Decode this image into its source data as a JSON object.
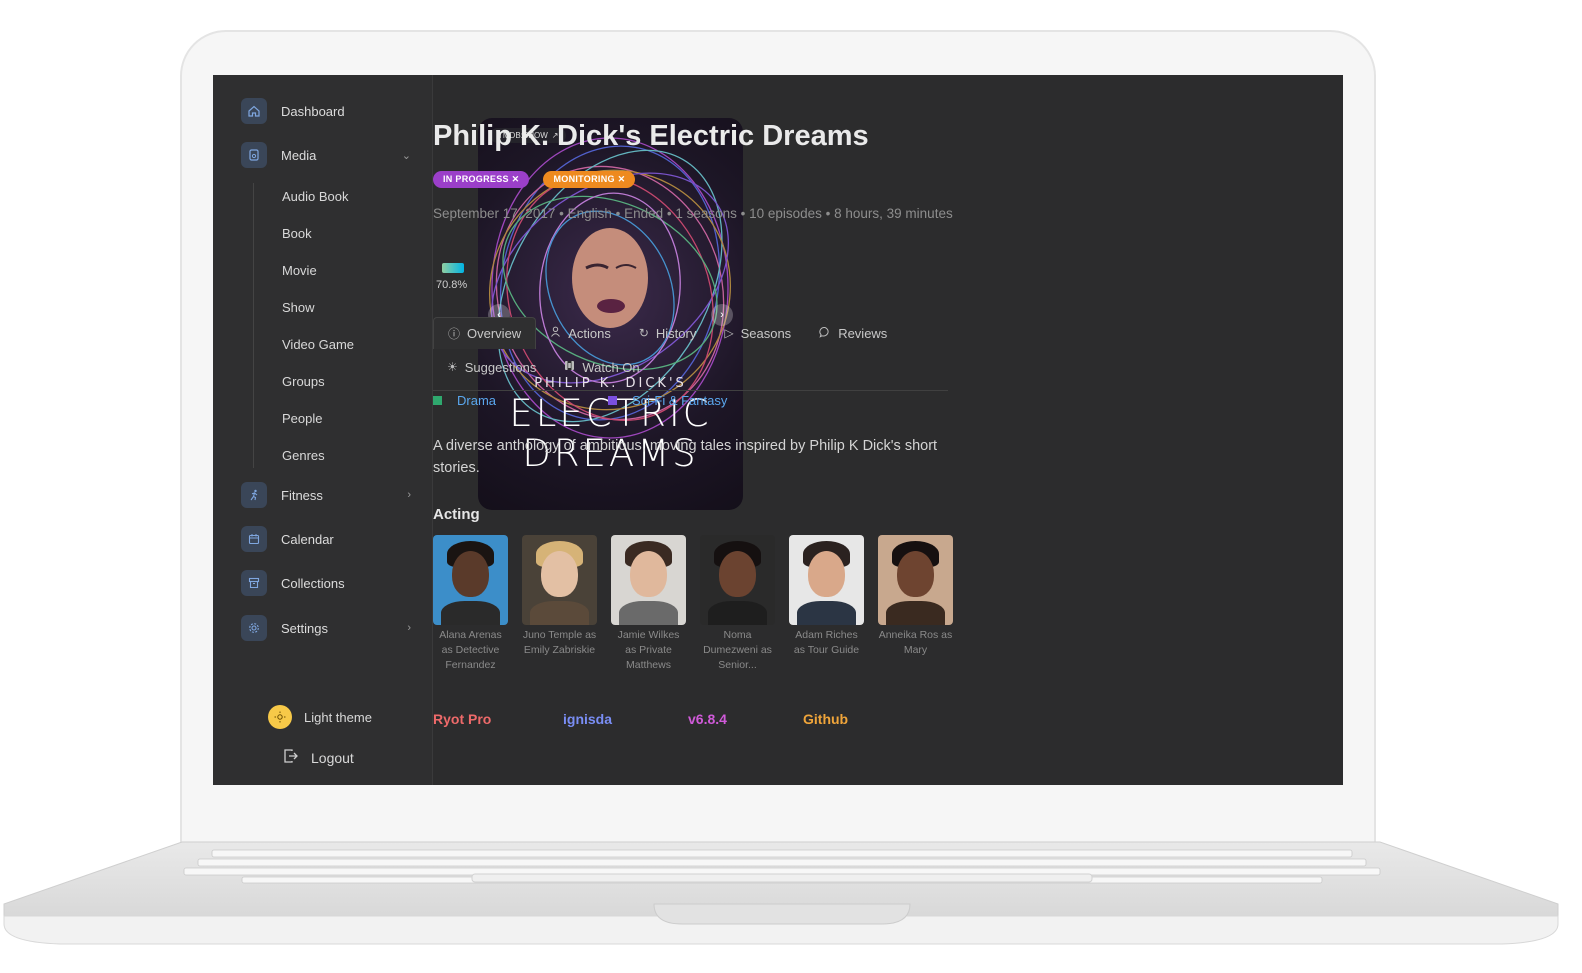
{
  "sidebar": {
    "items": [
      {
        "label": "Dashboard",
        "icon": "home-icon"
      },
      {
        "label": "Media",
        "icon": "media-icon"
      },
      {
        "label": "Fitness",
        "icon": "run-icon"
      },
      {
        "label": "Calendar",
        "icon": "calendar-icon"
      },
      {
        "label": "Collections",
        "icon": "archive-icon"
      },
      {
        "label": "Settings",
        "icon": "gear-icon"
      }
    ],
    "media_sub": [
      "Audio Book",
      "Book",
      "Movie",
      "Show",
      "Video Game",
      "Groups",
      "People",
      "Genres"
    ],
    "theme_label": "Light theme",
    "logout_label": "Logout"
  },
  "media": {
    "poster_badge": "TMDB:SHOW",
    "poster_title_small": "PHILIP K. DICK'S",
    "poster_title_big_1": "ELECTRIC",
    "poster_title_big_2": "DREAMS",
    "title": "Philip K. Dick's Electric Dreams",
    "tags": [
      {
        "label": "IN PROGRESS ✕",
        "color": "#9b3fc9"
      },
      {
        "label": "MONITORING ✕",
        "color": "#ee8a1f"
      }
    ],
    "meta": "September 17, 2017 • English • Ended • 1 seasons • 10 episodes • 8 hours, 39 minutes",
    "rating": "70.8%",
    "tabs": [
      {
        "label": "Overview",
        "icon": "info-icon"
      },
      {
        "label": "Actions",
        "icon": "user-icon"
      },
      {
        "label": "History",
        "icon": "history-icon"
      },
      {
        "label": "Seasons",
        "icon": "play-icon"
      },
      {
        "label": "Reviews",
        "icon": "comment-icon"
      },
      {
        "label": "Suggestions",
        "icon": "bulb-icon"
      },
      {
        "label": "Watch On",
        "icon": "film-icon"
      }
    ],
    "genres": [
      {
        "label": "Drama",
        "color": "#2fa86e"
      },
      {
        "label": "Sci-Fi & Fantasy",
        "color": "#7a4fe0"
      }
    ],
    "overview": "A diverse anthology of ambitious, moving tales inspired by Philip K Dick's short stories.",
    "acting_heading": "Acting",
    "cast": [
      {
        "name": "Alana Arenas as Detective Fernandez",
        "bg": "#3c8ec9",
        "skin": "#5a3a2a",
        "hair": "#1a1412",
        "cloth": "#2a2a2a"
      },
      {
        "name": "Juno Temple as Emily Zabriskie",
        "bg": "#4a4238",
        "skin": "#e3c0a4",
        "hair": "#d6b377",
        "cloth": "#5b4a3a"
      },
      {
        "name": "Jamie Wilkes as Private Matthews",
        "bg": "#d8d6d2",
        "skin": "#e0b89c",
        "hair": "#3a2a22",
        "cloth": "#6a6a6a"
      },
      {
        "name": "Noma Dumezweni as Senior...",
        "bg": "#2a2a2a",
        "skin": "#6b4330",
        "hair": "#151010",
        "cloth": "#1e1e1e"
      },
      {
        "name": "Adam Riches as Tour Guide",
        "bg": "#e7e7e7",
        "skin": "#d9a88a",
        "hair": "#2b2220",
        "cloth": "#2b3544"
      },
      {
        "name": "Anneika Ros as Mary",
        "bg": "#c8a88e",
        "skin": "#6e4430",
        "hair": "#161010",
        "cloth": "#3a2a20"
      }
    ]
  },
  "footer": [
    {
      "label": "Ryot Pro",
      "color": "#ee6a6a"
    },
    {
      "label": "ignisda",
      "color": "#7a8ef5"
    },
    {
      "label": "v6.8.4",
      "color": "#d05ad9"
    },
    {
      "label": "Github",
      "color": "#f0a53a"
    }
  ]
}
